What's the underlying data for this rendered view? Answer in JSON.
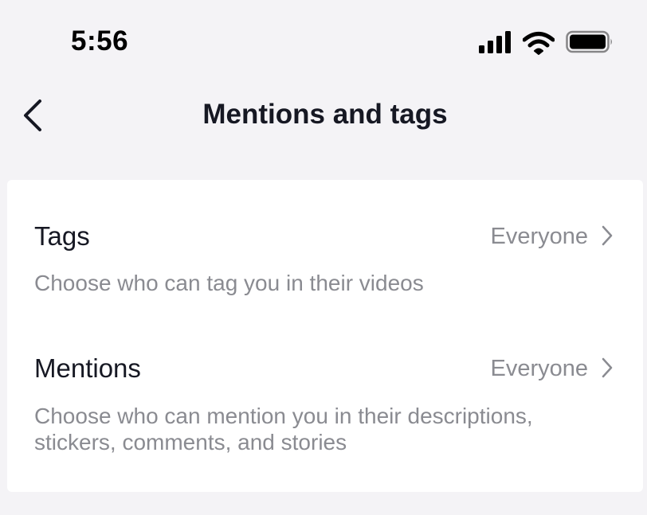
{
  "status_bar": {
    "time": "5:56",
    "icons": [
      "signal-icon",
      "wifi-icon",
      "battery-icon"
    ]
  },
  "nav": {
    "back_icon": "chevron-left-icon",
    "title": "Mentions and tags"
  },
  "settings": [
    {
      "title": "Tags",
      "value": "Everyone",
      "description": "Choose who can tag you in their videos"
    },
    {
      "title": "Mentions",
      "value": "Everyone",
      "description": "Choose who can mention you in their descriptions, stickers, comments, and stories"
    }
  ],
  "colors": {
    "background": "#f4f3f6",
    "card": "#ffffff",
    "primary_text": "#161823",
    "secondary_text": "#8a8b91"
  }
}
